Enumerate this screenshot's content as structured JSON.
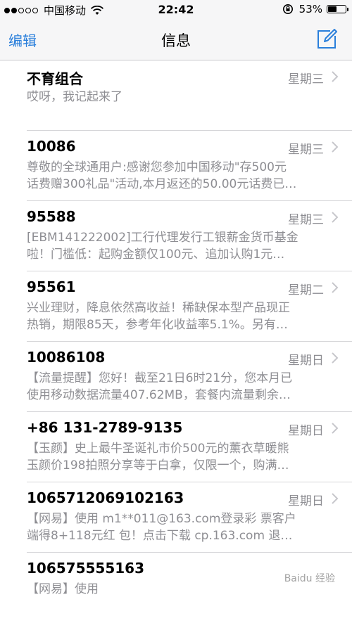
{
  "status_bar": {
    "carrier": "中国移动",
    "time": "22:42",
    "battery_percent": "53%",
    "battery_level": 0.53,
    "signal_bars_filled": 2,
    "signal_bars_total": 5
  },
  "nav": {
    "edit_label": "编辑",
    "title": "信息",
    "compose_icon": "compose-icon",
    "accent_color": "#2a7fdb"
  },
  "messages": [
    {
      "sender": "不育组合",
      "time": "星期三",
      "preview": "哎呀，我记起来了"
    },
    {
      "sender": "10086",
      "time": "星期三",
      "preview": "尊敬的全球通用户:感谢您参加中国移动\"存500元\n话费赠300礼品\"活动,本月返还的50.00元话费已…"
    },
    {
      "sender": "95588",
      "time": "星期三",
      "preview": "[EBM141222002]工行代理发行工银薪金货币基金\n啦！门槛低：起购金额仅100元、追加认购1元…"
    },
    {
      "sender": "95561",
      "time": "星期二",
      "preview": "兴业理财，降息依然高收益！稀缺保本型产品现正\n热销，期限85天，参考年化收益率5.1%。另有…"
    },
    {
      "sender": "10086108",
      "time": "星期日",
      "preview": "【流量提醒】您好！截至21日6时21分，您本月已\n使用移动数据流量407.62MB，套餐内流量剩余…"
    },
    {
      "sender": "+86 131-2789-9135",
      "time": "星期日",
      "preview": "【玉颜】史上最牛圣诞礼市价500元的薰衣草暖熊\n玉颜价198拍照分享等于白拿，仅限一个，购满…"
    },
    {
      "sender": "106571206910216З",
      "time": "星期日",
      "preview": "【网易】使用 m1**011@163.com登录彩 票客户\n端得8+118元红 包！点击下载 cp.163.com 退…"
    },
    {
      "sender": "106575555163",
      "time": "",
      "preview": "【网易】使用"
    }
  ],
  "watermark": "Baidu 经验"
}
